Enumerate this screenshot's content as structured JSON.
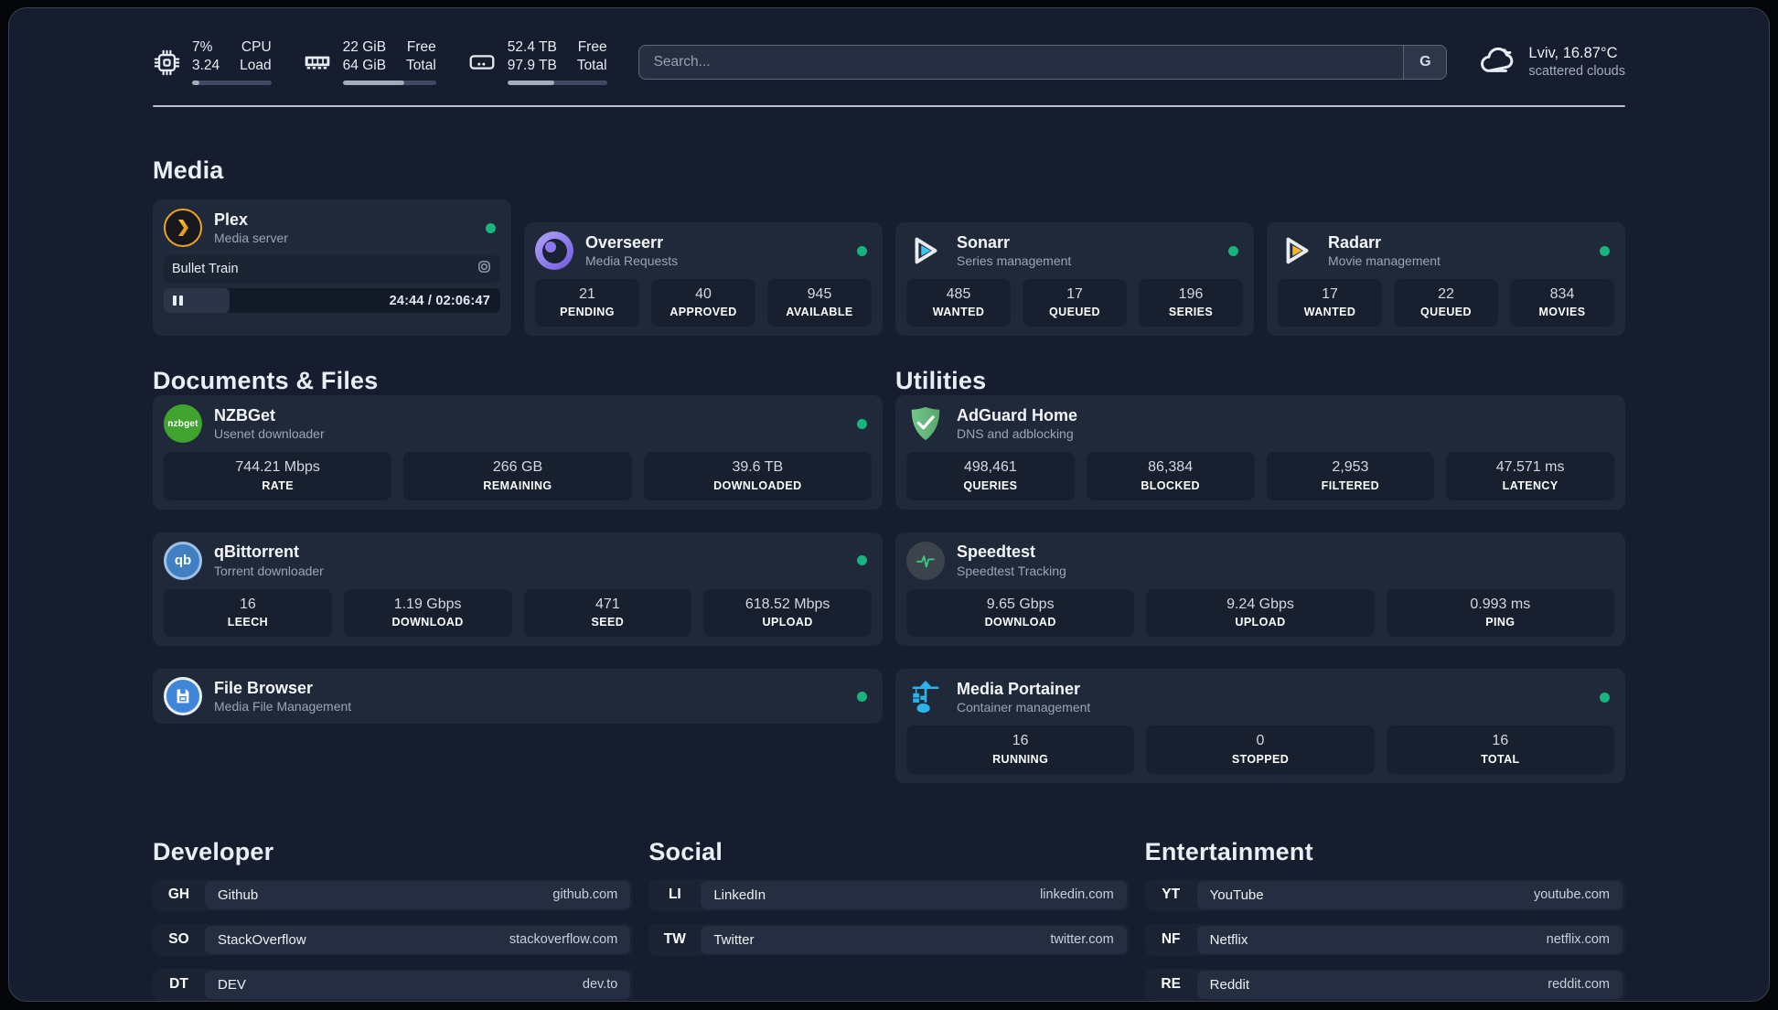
{
  "header": {
    "cpu": {
      "col1": [
        "7%",
        "3.24"
      ],
      "col2": [
        "CPU",
        "Load"
      ],
      "progress_pct": 9
    },
    "ram": {
      "col1": [
        "22 GiB",
        "64 GiB"
      ],
      "col2": [
        "Free",
        "Total"
      ],
      "progress_pct": 66
    },
    "disk": {
      "col1": [
        "52.4 TB",
        "97.9 TB"
      ],
      "col2": [
        "Free",
        "Total"
      ],
      "progress_pct": 47
    },
    "search": {
      "placeholder": "Search...",
      "button": "G"
    },
    "weather": {
      "location": "Lviv, 16.87°C",
      "condition": "scattered clouds"
    }
  },
  "sections": {
    "media": {
      "title": "Media",
      "cards": [
        {
          "name": "Plex",
          "desc": "Media server",
          "player": {
            "title": "Bullet Train",
            "time": "24:44 / 02:06:47",
            "progress_pct": 19.5
          }
        },
        {
          "name": "Overseerr",
          "desc": "Media Requests",
          "stats": [
            {
              "value": "21",
              "label": "PENDING"
            },
            {
              "value": "40",
              "label": "APPROVED"
            },
            {
              "value": "945",
              "label": "AVAILABLE"
            }
          ]
        },
        {
          "name": "Sonarr",
          "desc": "Series management",
          "stats": [
            {
              "value": "485",
              "label": "WANTED"
            },
            {
              "value": "17",
              "label": "QUEUED"
            },
            {
              "value": "196",
              "label": "SERIES"
            }
          ]
        },
        {
          "name": "Radarr",
          "desc": "Movie management",
          "stats": [
            {
              "value": "17",
              "label": "WANTED"
            },
            {
              "value": "22",
              "label": "QUEUED"
            },
            {
              "value": "834",
              "label": "MOVIES"
            }
          ]
        }
      ]
    },
    "documents": {
      "title": "Documents & Files",
      "cards": [
        {
          "name": "NZBGet",
          "desc": "Usenet downloader",
          "icon_text": "nzbget",
          "stats": [
            {
              "value": "744.21 Mbps",
              "label": "RATE"
            },
            {
              "value": "266 GB",
              "label": "REMAINING"
            },
            {
              "value": "39.6 TB",
              "label": "DOWNLOADED"
            }
          ]
        },
        {
          "name": "qBittorrent",
          "desc": "Torrent downloader",
          "icon_text": "qb",
          "stats": [
            {
              "value": "16",
              "label": "LEECH"
            },
            {
              "value": "1.19 Gbps",
              "label": "DOWNLOAD"
            },
            {
              "value": "471",
              "label": "SEED"
            },
            {
              "value": "618.52 Mbps",
              "label": "UPLOAD"
            }
          ]
        },
        {
          "name": "File Browser",
          "desc": "Media File Management"
        }
      ]
    },
    "utilities": {
      "title": "Utilities",
      "cards": [
        {
          "name": "AdGuard Home",
          "desc": "DNS and adblocking",
          "stats": [
            {
              "value": "498,461",
              "label": "QUERIES"
            },
            {
              "value": "86,384",
              "label": "BLOCKED"
            },
            {
              "value": "2,953",
              "label": "FILTERED"
            },
            {
              "value": "47.571 ms",
              "label": "LATENCY"
            }
          ]
        },
        {
          "name": "Speedtest",
          "desc": "Speedtest Tracking",
          "stats": [
            {
              "value": "9.65 Gbps",
              "label": "DOWNLOAD"
            },
            {
              "value": "9.24 Gbps",
              "label": "UPLOAD"
            },
            {
              "value": "0.993 ms",
              "label": "PING"
            }
          ]
        },
        {
          "name": "Media Portainer",
          "desc": "Container management",
          "stats": [
            {
              "value": "16",
              "label": "RUNNING"
            },
            {
              "value": "0",
              "label": "STOPPED"
            },
            {
              "value": "16",
              "label": "TOTAL"
            }
          ]
        }
      ]
    },
    "developer": {
      "title": "Developer",
      "links": [
        {
          "abbr": "GH",
          "name": "Github",
          "url": "github.com"
        },
        {
          "abbr": "SO",
          "name": "StackOverflow",
          "url": "stackoverflow.com"
        },
        {
          "abbr": "DT",
          "name": "DEV",
          "url": "dev.to"
        }
      ]
    },
    "social": {
      "title": "Social",
      "links": [
        {
          "abbr": "LI",
          "name": "LinkedIn",
          "url": "linkedin.com"
        },
        {
          "abbr": "TW",
          "name": "Twitter",
          "url": "twitter.com"
        }
      ]
    },
    "entertainment": {
      "title": "Entertainment",
      "links": [
        {
          "abbr": "YT",
          "name": "YouTube",
          "url": "youtube.com"
        },
        {
          "abbr": "NF",
          "name": "Netflix",
          "url": "netflix.com"
        },
        {
          "abbr": "RE",
          "name": "Reddit",
          "url": "reddit.com"
        }
      ]
    }
  }
}
